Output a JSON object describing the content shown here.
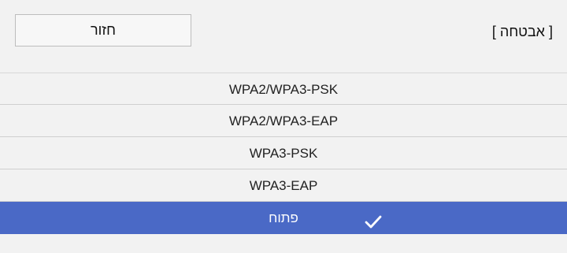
{
  "header": {
    "title": "[ אבטחה ]",
    "back_label": "חזור"
  },
  "options": [
    {
      "label": "WPA2/WPA3-PSK",
      "selected": false
    },
    {
      "label": "WPA2/WPA3-EAP",
      "selected": false
    },
    {
      "label": "WPA3-PSK",
      "selected": false
    },
    {
      "label": "WPA3-EAP",
      "selected": false
    },
    {
      "label": "פתוח",
      "selected": true,
      "icon": "check-icon"
    }
  ],
  "colors": {
    "background": "#f2f2f2",
    "selected_row": "#4a69c6",
    "selected_text": "#ffffff"
  }
}
